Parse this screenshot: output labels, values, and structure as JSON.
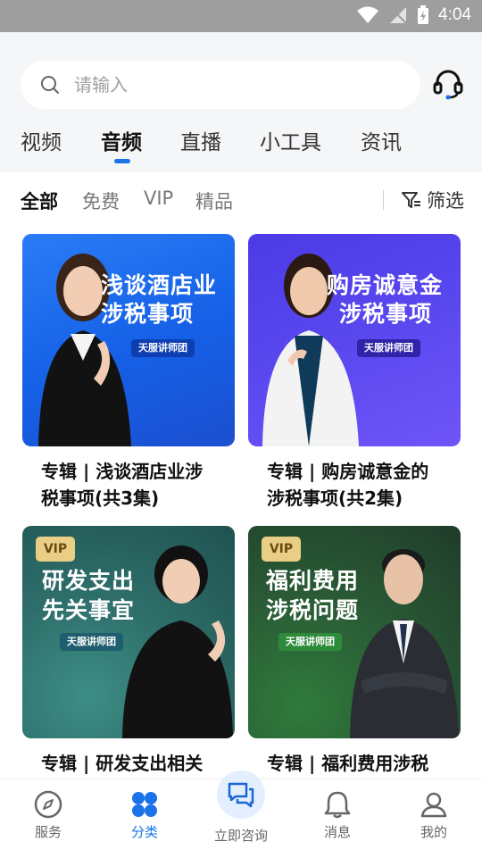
{
  "status_bar": {
    "time": "4:04"
  },
  "search": {
    "placeholder": "请输入"
  },
  "tabs": [
    {
      "label": "视频"
    },
    {
      "label": "音频"
    },
    {
      "label": "直播"
    },
    {
      "label": "小工具"
    },
    {
      "label": "资讯"
    }
  ],
  "active_tab": "音频",
  "filters": [
    {
      "label": "全部"
    },
    {
      "label": "免费"
    },
    {
      "label": "VIP"
    },
    {
      "label": "精品"
    }
  ],
  "filter_button": {
    "label": "筛选"
  },
  "cards": [
    {
      "image_line1": "浅谈酒店业",
      "image_line2": "涉税事项",
      "badge": "天服讲师团",
      "title": "专辑 | 浅谈酒店业涉税事项(共3集)"
    },
    {
      "image_line1": "购房诚意金",
      "image_line2": "涉税事项",
      "badge": "天服讲师团",
      "title": "专辑 | 购房诚意金的涉税事项(共2集)"
    },
    {
      "image_line1": "研发支出",
      "image_line2": "先关事宜",
      "badge": "天服讲师团",
      "vip": "VIP",
      "title": "专辑 | 研发支出相关"
    },
    {
      "image_line1": "福利费用",
      "image_line2": "涉税问题",
      "badge": "天服讲师团",
      "vip": "VIP",
      "title": "专辑 | 福利费用涉税"
    }
  ],
  "bottom_nav": [
    {
      "label": "服务"
    },
    {
      "label": "分类"
    },
    {
      "label": "立即咨询"
    },
    {
      "label": "消息"
    },
    {
      "label": "我的"
    }
  ],
  "colors": {
    "accent": "#1a73e8",
    "vip_gold": "#e9cf86"
  }
}
